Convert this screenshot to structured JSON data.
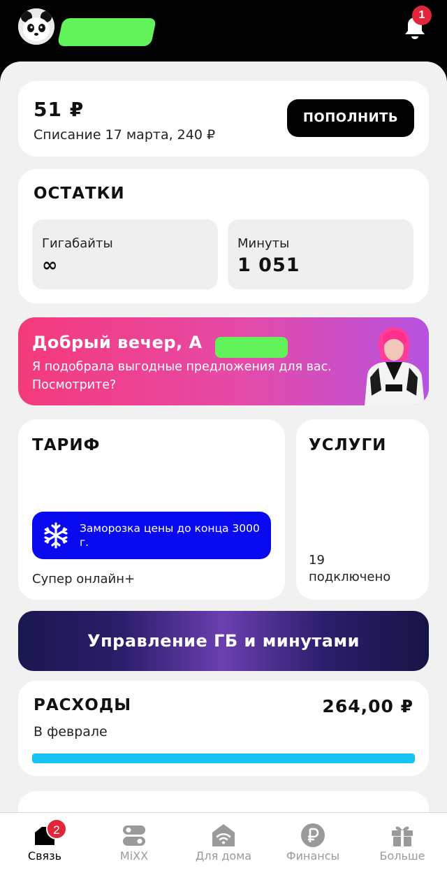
{
  "header": {
    "notifications_count": "1"
  },
  "balance": {
    "amount": "51 ₽",
    "charge_info": "Списание 17 марта, 240 ₽",
    "topup_label": "ПОПОЛНИТЬ"
  },
  "remains": {
    "title": "ОСТАТКИ",
    "gigabytes_label": "Гигабайты",
    "gigabytes_value": "∞",
    "minutes_label": "Минуты",
    "minutes_value": "1 051"
  },
  "promo": {
    "greeting": "Добрый вечер, А",
    "text": "Я подобрала выгодные предложения для вас. Посмотрите?"
  },
  "tariff": {
    "title": "ТАРИФ",
    "freeze_text": "Заморозка цены до конца 3000 г.",
    "name": "Супер онлайн+"
  },
  "services": {
    "title": "УСЛУГИ",
    "count": "19",
    "count_label": "подключено"
  },
  "manage_button": "Управление ГБ и минутами",
  "expenses": {
    "title": "РАСХОДЫ",
    "amount": "264,00 ₽",
    "period": "В феврале",
    "progress": 1.0
  },
  "tabs": [
    {
      "label": "Связь",
      "badge": "2",
      "active": true
    },
    {
      "label": "MiXX"
    },
    {
      "label": "Для дома"
    },
    {
      "label": "Финансы"
    },
    {
      "label": "Больше"
    }
  ],
  "colors": {
    "accent_blue": "#0a0af0",
    "progress": "#16c2f2",
    "badge": "#e0263a",
    "promo_start": "#f53a7c",
    "promo_end": "#b653e0"
  }
}
